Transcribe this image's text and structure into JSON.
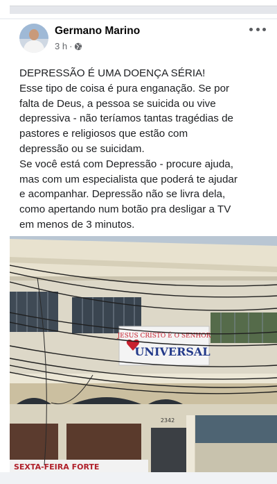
{
  "post": {
    "author": "Germano Marino",
    "time": "3 h",
    "dot": "·",
    "text_lines": [
      "DEPRESSÃO É UMA DOENÇA SÉRIA!",
      "Esse tipo de coisa é pura enganação. Se por",
      "falta de Deus, a pessoa se suicida ou vive",
      "depressiva - não teríamos tantas tragédias de",
      "pastores e religiosos que estão com",
      "depressão ou se suicidam.",
      "Se você está com Depressão - procure ajuda,",
      "mas com um especialista que poderá te ajudar",
      "e acompanhar. Depressão não se livra dela,",
      "como apertando num botão pra desligar a TV",
      "em menos de 3 minutos."
    ]
  },
  "photo": {
    "sign_line1": "JESUS CRISTO É O SENHOR",
    "sign_line2": "UNIVERSAL",
    "building_number": "2342",
    "banner_text": "SEXTA-FEIRA FORTE"
  },
  "icons": {
    "privacy": "globe-icon",
    "menu": "more-options-icon"
  },
  "colors": {
    "meta_gray": "#65676b",
    "sign_red": "#c8202f",
    "sign_navy": "#233a8a"
  }
}
